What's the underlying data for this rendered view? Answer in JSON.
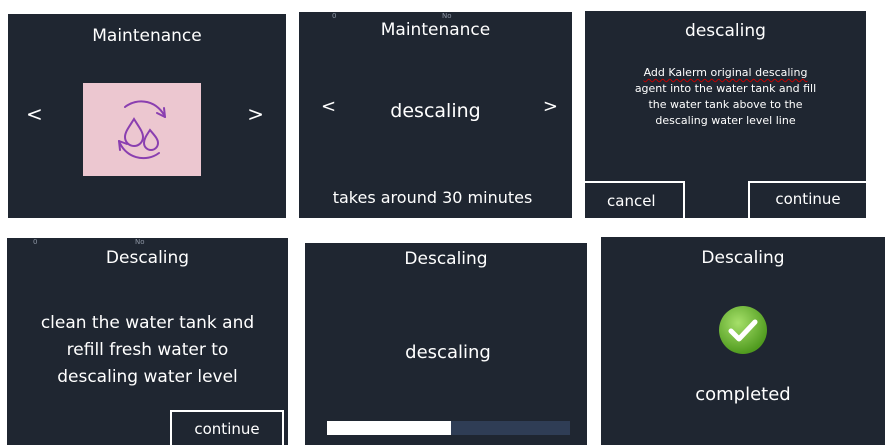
{
  "colors": {
    "screen_bg": "#1f2631",
    "icon_tile": "#ecc7d0",
    "icon_stroke": "#8a3fb0",
    "progress_track": "#2f3d55",
    "progress_fill": "#ffffff",
    "check_green": "#68bb2c"
  },
  "panel1": {
    "title": "Maintenance",
    "prev": "<",
    "next": ">",
    "icon": "water-drops-cycle-icon"
  },
  "panel2": {
    "title": "Maintenance",
    "prev": "<",
    "next": ">",
    "option": "descaling",
    "note": "takes around 30 minutes",
    "faint_left": "0",
    "faint_right": "No"
  },
  "panel3": {
    "title": "descaling",
    "body_lines": [
      "Add Kalerm original descaling",
      "agent into the water tank and fill",
      "the water tank above to the",
      "descaling water level line"
    ],
    "cancel": "cancel",
    "continue": "continue"
  },
  "panel4": {
    "title": "Descaling",
    "body_lines": [
      "clean the water tank and",
      "refill fresh water to",
      "descaling water level"
    ],
    "continue": "continue",
    "faint_left": "0",
    "faint_right": "No"
  },
  "panel5": {
    "title": "Descaling",
    "status": "descaling",
    "progress": 0.51
  },
  "panel6": {
    "title": "Descaling",
    "status": "completed",
    "icon": "check-circle-icon"
  }
}
